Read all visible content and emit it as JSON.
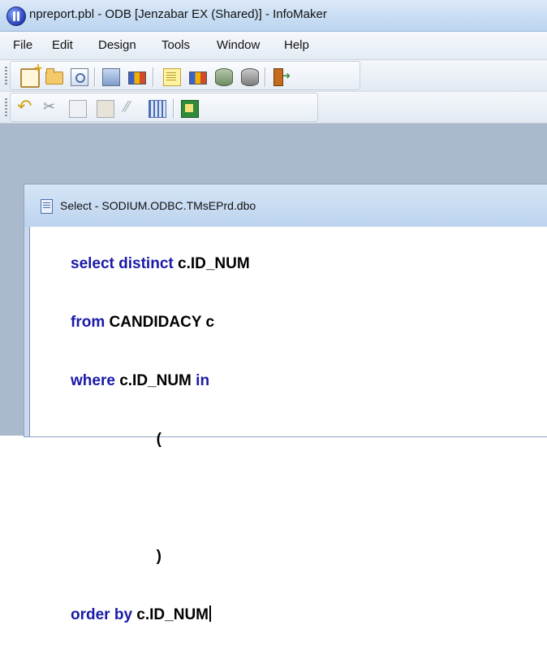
{
  "window": {
    "title": "npreport.pbl - ODB [Jenzabar EX (Shared)]  - InfoMaker"
  },
  "menu": {
    "items": [
      "File",
      "Edit",
      "Design",
      "Tools",
      "Window",
      "Help"
    ]
  },
  "toolbar1": {
    "icons": [
      "new-icon",
      "open-folder-icon",
      "preview-icon",
      "scan-icon",
      "bars-chart-icon",
      "notepad-icon",
      "bars-yellow-icon",
      "database-icon",
      "database-grey-icon",
      "exit-icon"
    ]
  },
  "toolbar2": {
    "icons": [
      "undo-icon",
      "cut-icon",
      "copy-icon",
      "paste-icon",
      "clear-icon",
      "grid-icon",
      "book-icon"
    ]
  },
  "child_window": {
    "title": "Select - SODIUM.ODBC.TMsEPrd.dbo"
  },
  "editor": {
    "lines": [
      {
        "kw": "select distinct",
        "rest": " c.ID_NUM"
      },
      {
        "kw": "from",
        "rest": " CANDIDACY c"
      },
      {
        "kw": "where",
        "mid": " c.ID_NUM ",
        "kw2": "in"
      },
      {
        "pad": "                    ",
        "rest": "("
      },
      {
        "rest": ""
      },
      {
        "pad": "                    ",
        "rest": ")"
      },
      {
        "kw": "order by",
        "rest": " c.ID_NUM"
      }
    ]
  }
}
